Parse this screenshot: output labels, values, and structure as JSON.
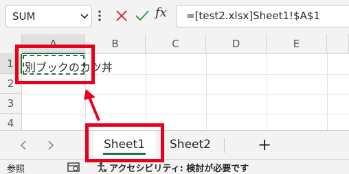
{
  "formula_bar": {
    "name_box": "SUM",
    "formula": "=[test2.xlsx]Sheet1!$A$1"
  },
  "grid": {
    "columns": [
      "A",
      "B",
      "C",
      "D",
      "E"
    ],
    "rows": [
      "1",
      "2",
      "3",
      "4"
    ],
    "cell_a1": "別ブックのカツ丼"
  },
  "sheet_tabs": {
    "tabs": [
      "Sheet1",
      "Sheet2"
    ],
    "add_label": "+",
    "active_color": "#217346"
  },
  "status_bar": {
    "mode": "参照",
    "accessibility": "アクセシビリティ: 検討が必要です"
  },
  "annotation_color": "#e8001c"
}
